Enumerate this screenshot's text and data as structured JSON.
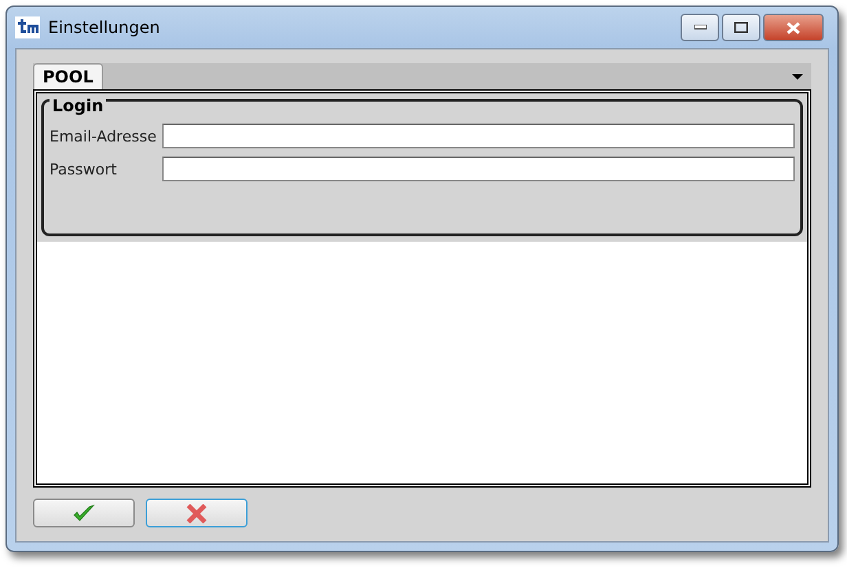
{
  "window": {
    "title": "Einstellungen"
  },
  "tabs": [
    {
      "label": "POOL",
      "selected": true
    }
  ],
  "group": {
    "title": "Login"
  },
  "fields": [
    {
      "label": "Email-Adresse"
    },
    {
      "label": "Passwort"
    }
  ],
  "buttons": [
    {
      "kind": "ok",
      "focused": false
    },
    {
      "kind": "cancel",
      "focused": true
    }
  ]
}
